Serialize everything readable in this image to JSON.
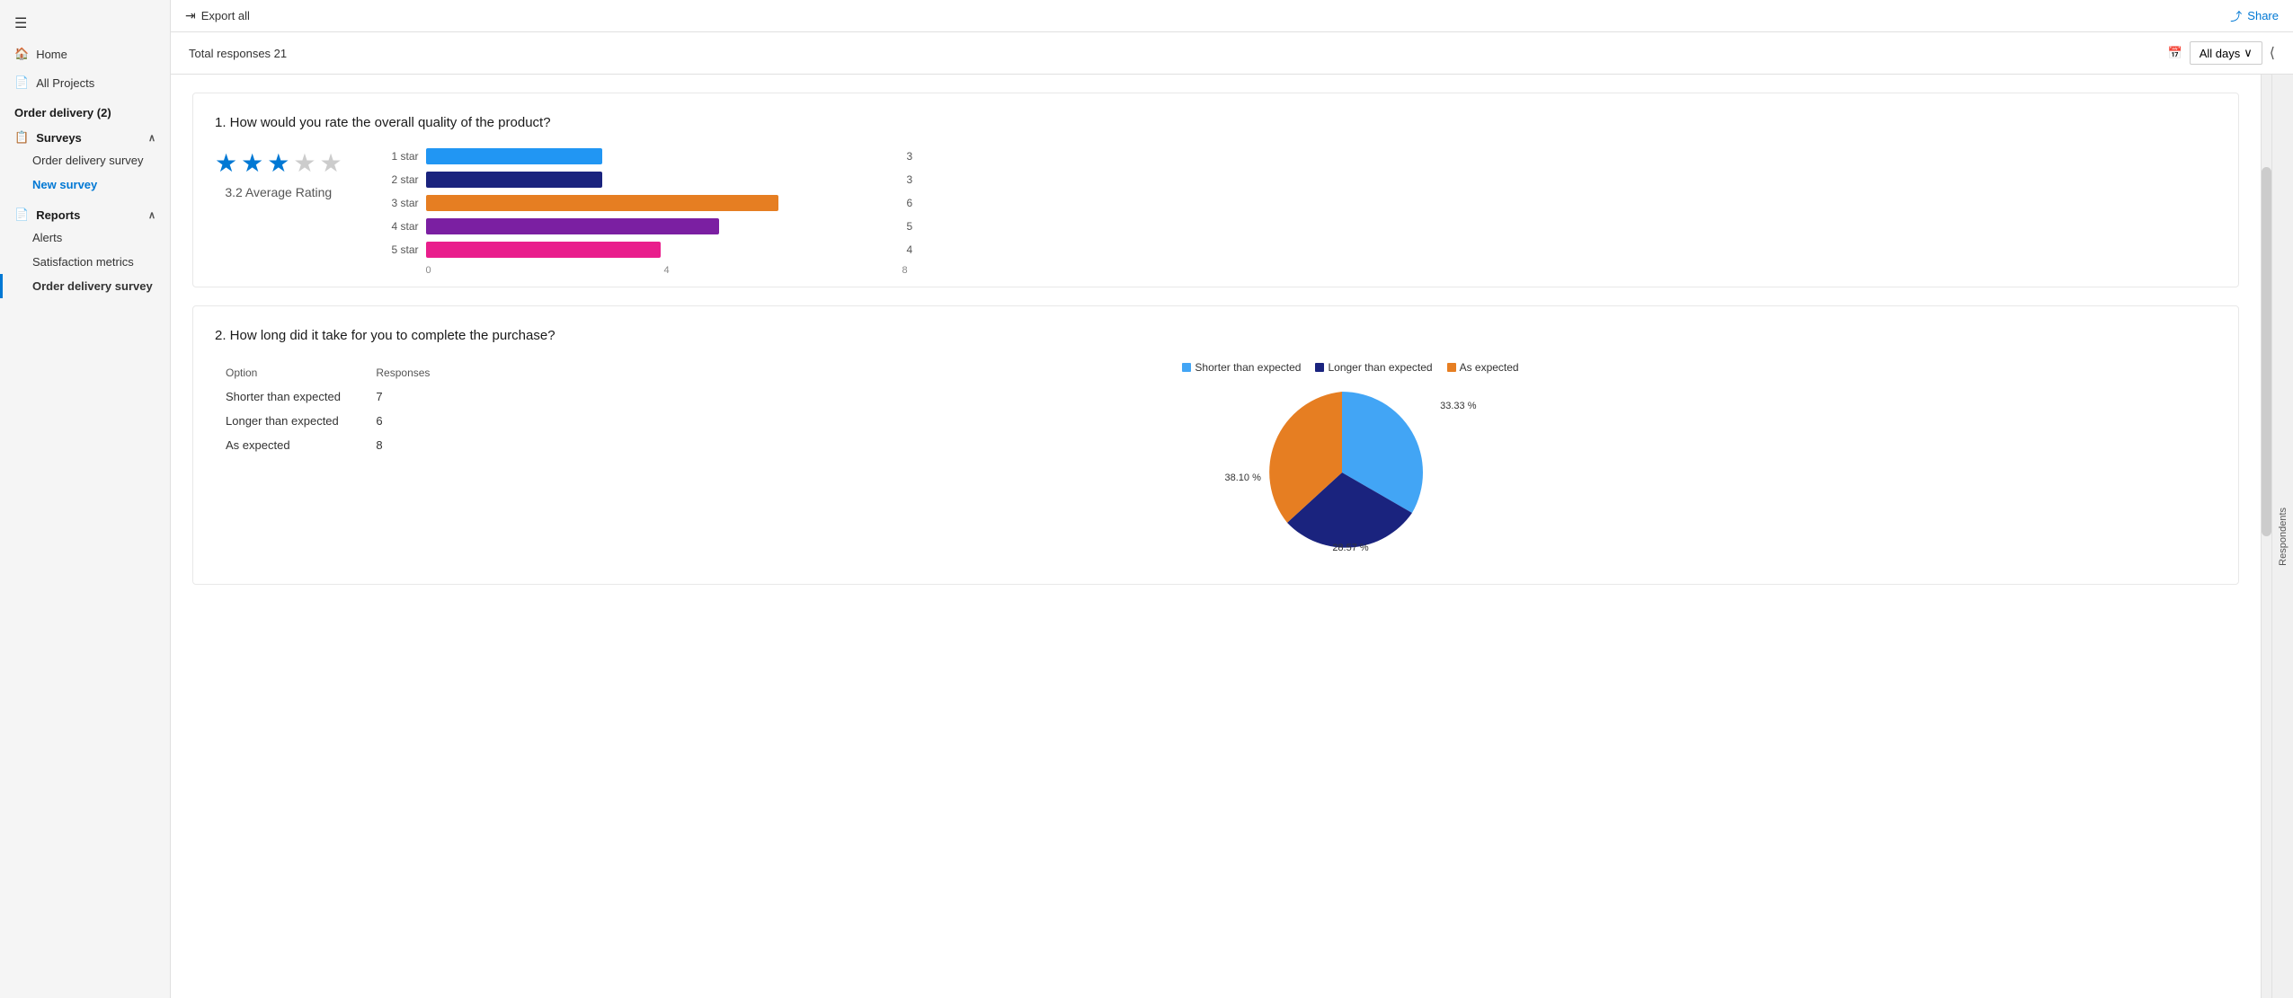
{
  "sidebar": {
    "menu_icon": "☰",
    "home_label": "Home",
    "all_projects_label": "All Projects",
    "section_title": "Order delivery (2)",
    "surveys_label": "Surveys",
    "surveys_items": [
      {
        "label": "Order delivery survey",
        "active": false
      },
      {
        "label": "New survey",
        "active": true
      }
    ],
    "reports_label": "Reports",
    "reports_items": [
      {
        "label": "Alerts",
        "active": false
      },
      {
        "label": "Satisfaction metrics",
        "active": false
      },
      {
        "label": "Order delivery survey",
        "active": true
      }
    ]
  },
  "topbar": {
    "export_label": "Export all",
    "share_label": "Share"
  },
  "responses_bar": {
    "total_label": "Total responses 21",
    "filter_label": "All days"
  },
  "question1": {
    "title": "1. How would you rate the overall quality of the product?",
    "avg_rating": "3.2 Average Rating",
    "stars_filled": 3,
    "stars_empty": 2,
    "bars": [
      {
        "label": "1 star",
        "value": 3,
        "max": 8,
        "color": "#2196F3"
      },
      {
        "label": "2 star",
        "value": 3,
        "max": 8,
        "color": "#1A237E"
      },
      {
        "label": "3 star",
        "value": 6,
        "max": 8,
        "color": "#E67E22"
      },
      {
        "label": "4 star",
        "value": 5,
        "max": 8,
        "color": "#7B1FA2"
      },
      {
        "label": "5 star",
        "value": 4,
        "max": 8,
        "color": "#E91E8C"
      }
    ],
    "x_ticks": [
      "0",
      "4",
      "8"
    ]
  },
  "question2": {
    "title": "2. How long did it take for you to complete the purchase?",
    "legend": [
      {
        "label": "Shorter than expected",
        "color": "#42A5F5"
      },
      {
        "label": "Longer than expected",
        "color": "#1A237E"
      },
      {
        "label": "As expected",
        "color": "#E67E22"
      }
    ],
    "table_headers": [
      "Option",
      "Responses"
    ],
    "table_rows": [
      {
        "option": "Shorter than expected",
        "responses": "7"
      },
      {
        "option": "Longer than expected",
        "responses": "6"
      },
      {
        "option": "As expected",
        "responses": "8"
      }
    ],
    "pie": {
      "shorter_pct": 33.33,
      "longer_pct": 28.57,
      "expected_pct": 38.1,
      "shorter_label": "33.33 %",
      "longer_label": "28.57 %",
      "expected_label": "38.10 %"
    }
  },
  "respondents_tab": "Respondents"
}
